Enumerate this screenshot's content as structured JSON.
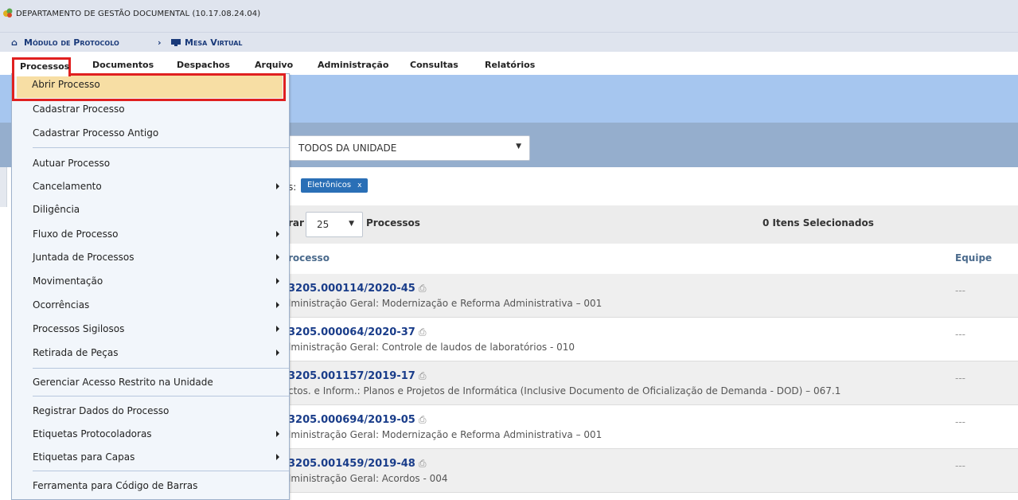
{
  "header": {
    "department": "DEPARTAMENTO DE GESTÃO DOCUMENTAL (10.17.08.24.04)",
    "breadcrumb": [
      "Módulo de Protocolo",
      "Mesa Virtual"
    ],
    "breadcrumb_sep": "›"
  },
  "menu": [
    "Processos",
    "Documentos",
    "Despachos",
    "Arquivo",
    "Administração",
    "Consultas",
    "Relatórios"
  ],
  "dropdown": [
    {
      "label": "Abrir Processo"
    },
    {
      "label": "Cadastrar Processo"
    },
    {
      "label": "Cadastrar Processo Antigo"
    },
    {
      "label": "Autuar Processo"
    },
    {
      "label": "Cancelamento"
    },
    {
      "label": "Diligência"
    },
    {
      "label": "Fluxo de Processo"
    },
    {
      "label": "Juntada de Processos"
    },
    {
      "label": "Movimentação"
    },
    {
      "label": "Ocorrências"
    },
    {
      "label": "Processos Sigilosos"
    },
    {
      "label": "Retirada de Peças"
    },
    {
      "label": "Gerenciar Acesso Restrito na Unidade"
    },
    {
      "label": "Registrar Dados do Processo"
    },
    {
      "label": "Etiquetas Protocoladoras"
    },
    {
      "label": "Etiquetas para Capas"
    },
    {
      "label": "Ferramenta para Código de Barras"
    }
  ],
  "filter": {
    "select_value": "TODOS DA UNIDADE",
    "label": "s:",
    "chip": "Eletrônicos",
    "chip_close": "x"
  },
  "list": {
    "show_prefix": "rar",
    "page_size": "25",
    "processes_label": "Processos",
    "selected_label": "0 Itens Selecionados",
    "col_process": "rocesso",
    "col_team": "Equipe",
    "rows": [
      {
        "number": "3205.000114/2020-45",
        "desc": "lministração Geral: Modernização e Reforma Administrativa – 001",
        "team": "---"
      },
      {
        "number": "3205.000064/2020-37",
        "desc": "lministração Geral: Controle de laudos de laboratórios - 010",
        "team": "---"
      },
      {
        "number": "3205.001157/2019-17",
        "desc": "ctos. e Inform.: Planos e Projetos de Informática (Inclusive Documento de Oficialização de Demanda - DOD) – 067.1",
        "team": "---"
      },
      {
        "number": "3205.000694/2019-05",
        "desc": "lministração Geral: Modernização e Reforma Administrativa – 001",
        "team": "---"
      },
      {
        "number": "3205.001459/2019-48",
        "desc": "lministração Geral: Acordos - 004",
        "team": "---"
      }
    ]
  },
  "colors": {
    "accent": "#e02020",
    "link": "#1a3d8a",
    "band": "#a6c6ef",
    "band_dark": "#95aecd"
  }
}
